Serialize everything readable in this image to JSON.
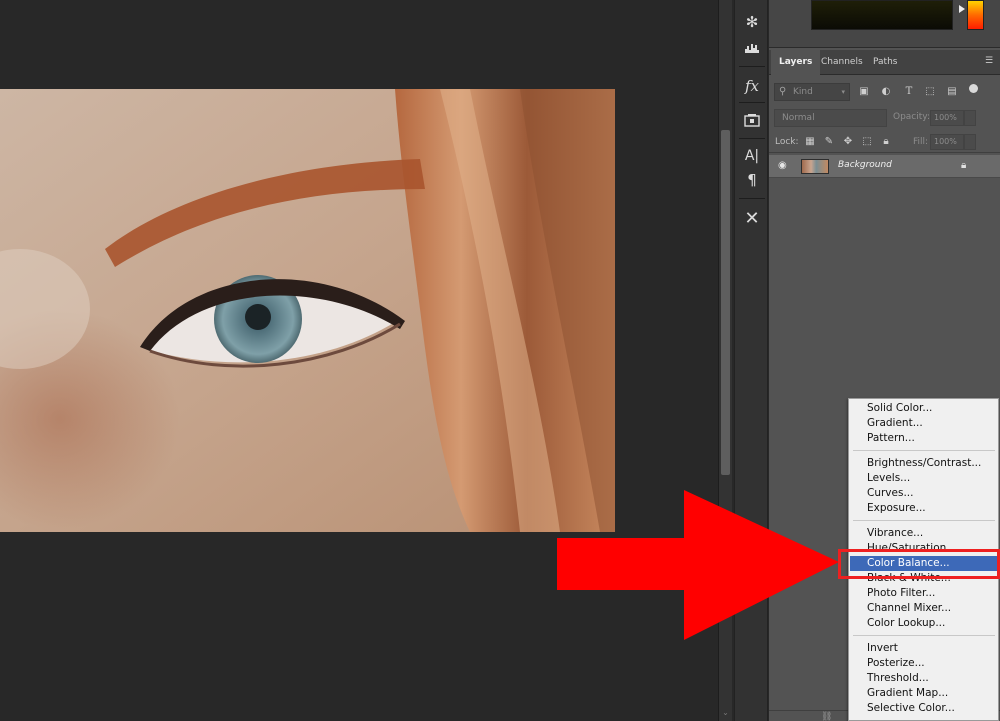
{
  "layers_panel": {
    "tabs": [
      {
        "label": "Layers",
        "active": true
      },
      {
        "label": "Channels",
        "active": false
      },
      {
        "label": "Paths",
        "active": false
      }
    ],
    "filter": {
      "kind_label": "Kind"
    },
    "blend_mode": "Normal",
    "opacity_label": "Opacity:",
    "opacity_value": "100%",
    "lock_label": "Lock:",
    "fill_label": "Fill:",
    "fill_value": "100%",
    "layers": [
      {
        "name": "Background",
        "visible": true,
        "locked": true
      }
    ]
  },
  "adjustment_menu": {
    "groups": [
      {
        "items": [
          {
            "label": "Solid Color..."
          },
          {
            "label": "Gradient..."
          },
          {
            "label": "Pattern..."
          }
        ]
      },
      {
        "items": [
          {
            "label": "Brightness/Contrast..."
          },
          {
            "label": "Levels..."
          },
          {
            "label": "Curves..."
          },
          {
            "label": "Exposure..."
          }
        ]
      },
      {
        "items": [
          {
            "label": "Vibrance..."
          },
          {
            "label": "Hue/Saturation..."
          },
          {
            "label": "Color Balance...",
            "highlighted": true
          },
          {
            "label": "Black & White..."
          },
          {
            "label": "Photo Filter..."
          },
          {
            "label": "Channel Mixer..."
          },
          {
            "label": "Color Lookup..."
          }
        ]
      },
      {
        "items": [
          {
            "label": "Invert"
          },
          {
            "label": "Posterize..."
          },
          {
            "label": "Threshold..."
          },
          {
            "label": "Gradient Map..."
          },
          {
            "label": "Selective Color..."
          }
        ]
      }
    ]
  },
  "tool_strip": {
    "icons": [
      "snowflake-icon",
      "histogram-icon",
      "fx-icon",
      "library-icon",
      "character-icon",
      "paragraph-icon",
      "tools-icon"
    ]
  },
  "colors": {
    "canvas_bg": "#282828",
    "panel_bg": "#535353",
    "menu_highlight": "#3d69b8",
    "annotation_red": "#ee2020"
  }
}
